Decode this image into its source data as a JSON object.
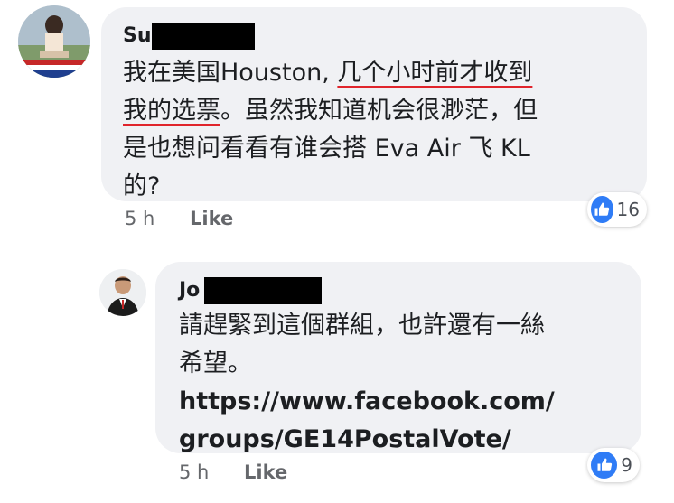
{
  "comments": [
    {
      "author_visible": "Su",
      "text": {
        "line1_a": "我在美国Houston, ",
        "line1_b": "几个小时前才收到",
        "line2_a": "我的选票",
        "line2_b": "。虽然我知道机会很渺茫，但",
        "line3": "是也想问看看有谁会搭 Eva Air 飞 KL",
        "line4": "的?"
      },
      "time": "5 h",
      "like_label": "Like",
      "reaction_count": "16"
    },
    {
      "author_visible": "Jo",
      "text": {
        "line1": "請趕緊到這個群組，也許還有一絲",
        "line2": "希望。",
        "link_line1": "https://www.facebook.com/",
        "link_line2": "groups/GE14PostalVote/"
      },
      "time": "5 h",
      "like_label": "Like",
      "reaction_count": "9"
    }
  ],
  "colors": {
    "bubble": "#f0f1f4",
    "underline": "#e0242b",
    "like_badge": "#2f7cf6",
    "meta_text": "#65676b"
  },
  "icons": [
    "thumbs-up-icon",
    "profile-photo-woman",
    "profile-photo-man"
  ]
}
